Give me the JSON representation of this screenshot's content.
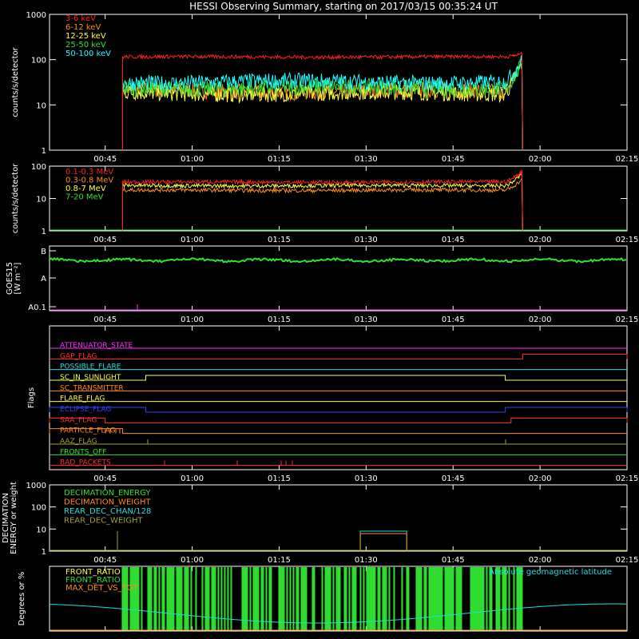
{
  "title": "HESSI Observing Summary, starting on 2017/03/15 00:35:24 UT",
  "time_ticks": [
    "00:45",
    "01:00",
    "01:15",
    "01:30",
    "01:45",
    "02:00",
    "02:15"
  ],
  "chart_data": [
    {
      "type": "line",
      "panel": "low-energy",
      "ylabel": "counts/s/detector",
      "yscale": "log",
      "ylim": [
        1,
        1000
      ],
      "ytick_labels": [
        "1",
        "10",
        "100",
        "1000"
      ],
      "data_window": [
        "00:48",
        "01:57"
      ],
      "series": [
        {
          "name": "3-6 keV",
          "color": "#ff2020",
          "level": 115,
          "end_level": 135
        },
        {
          "name": "6-12 keV",
          "color": "#ff8c1a",
          "level": 20,
          "end_level": 80
        },
        {
          "name": "12-25 keV",
          "color": "#ffff40",
          "level": 18,
          "end_level": 90
        },
        {
          "name": "25-50 keV",
          "color": "#30e030",
          "level": 24,
          "end_level": 85
        },
        {
          "name": "50-100 keV",
          "color": "#20ffff",
          "level": 32,
          "end_level": 95
        }
      ]
    },
    {
      "type": "line",
      "panel": "high-energy",
      "ylabel": "counts/s/detector",
      "yscale": "log",
      "ylim": [
        1,
        100
      ],
      "ytick_labels": [
        "1",
        "10",
        "100"
      ],
      "data_window": [
        "00:48",
        "01:57"
      ],
      "series": [
        {
          "name": "0.1-0.3 MeV",
          "color": "#ff2020",
          "level": 32,
          "end_level": 70
        },
        {
          "name": "0.3-0.8 MeV",
          "color": "#ff8c1a",
          "level": 18,
          "end_level": 40
        },
        {
          "name": "0.8-7 MeV",
          "color": "#ffff40",
          "level": 25,
          "end_level": 60
        },
        {
          "name": "7-20 MeV",
          "color": "#30e030",
          "level": 1,
          "end_level": 1
        }
      ]
    },
    {
      "type": "line",
      "panel": "goes",
      "ylabel": "GOES15",
      "ylabel2": "[W m⁻²]",
      "ytick_labels": [
        "A0.1",
        "A",
        "B"
      ],
      "series": [
        {
          "name": "GOES flux",
          "color": "#30e030",
          "level": 0.78
        }
      ]
    },
    {
      "type": "line",
      "panel": "flags",
      "ylabel": "Flags",
      "series": [
        {
          "name": "ATTENUATOR_STATE",
          "color": "#ff30ff",
          "on": []
        },
        {
          "name": "GAP_FLAG",
          "color": "#ff3030",
          "on": [
            [
              "01:57",
              "02:15"
            ]
          ]
        },
        {
          "name": "POSSIBLE_FLARE",
          "color": "#20e0e0",
          "on": []
        },
        {
          "name": "SC_IN_SUNLIGHT",
          "color": "#ffff40",
          "on": [
            [
              "00:52",
              "01:54"
            ]
          ]
        },
        {
          "name": "SC_TRANSMITTER",
          "color": "#ff8c1a",
          "on": []
        },
        {
          "name": "FLARE_FLAG",
          "color": "#ffff40",
          "on": []
        },
        {
          "name": "ECLIPSE_FLAG",
          "color": "#3040ff",
          "on": [
            [
              "00:35",
              "00:52"
            ],
            [
              "01:54",
              "02:15"
            ]
          ]
        },
        {
          "name": "SAA_FLAG",
          "color": "#ff3030",
          "on": [
            [
              "00:35",
              "00:45"
            ],
            [
              "01:55",
              "02:15"
            ]
          ]
        },
        {
          "name": "PARTICLE_FLAG",
          "color": "#ff8c1a",
          "on": [
            [
              "00:35",
              "00:48"
            ]
          ]
        },
        {
          "name": "AAZ_FLAG",
          "color": "#a0a030",
          "on": []
        },
        {
          "name": "FRONTS_OFF",
          "color": "#30e030",
          "on": []
        },
        {
          "name": "BAD_PACKETS",
          "color": "#ff3030",
          "on": []
        }
      ]
    },
    {
      "type": "line",
      "panel": "decimation",
      "ylabel": "DECIMATION",
      "ylabel2": "ENERGY or weight",
      "yscale": "log",
      "ylim": [
        1,
        1000
      ],
      "ytick_labels": [
        "1",
        "10",
        "100",
        "1000"
      ],
      "series": [
        {
          "name": "DECIMATION_ENERGY",
          "color": "#30e030"
        },
        {
          "name": "DECIMATION_WEIGHT",
          "color": "#ff8c1a"
        },
        {
          "name": "REAR_DEC_CHAN/128",
          "color": "#20e0e0"
        },
        {
          "name": "REAR_DEC_WEIGHT",
          "color": "#a0a030"
        }
      ]
    },
    {
      "type": "line",
      "panel": "ratio",
      "ylabel": "Degrees or %",
      "series": [
        {
          "name": "FRONT_RATIO",
          "color": "#ffff40"
        },
        {
          "name": "FRONT_RATIO",
          "color": "#30e030"
        },
        {
          "name": "MAX_DET_VS_TOT",
          "color": "#ff8c1a"
        },
        {
          "name": "Absolute geomagnetic latitude",
          "color": "#20e0e0"
        }
      ]
    }
  ]
}
